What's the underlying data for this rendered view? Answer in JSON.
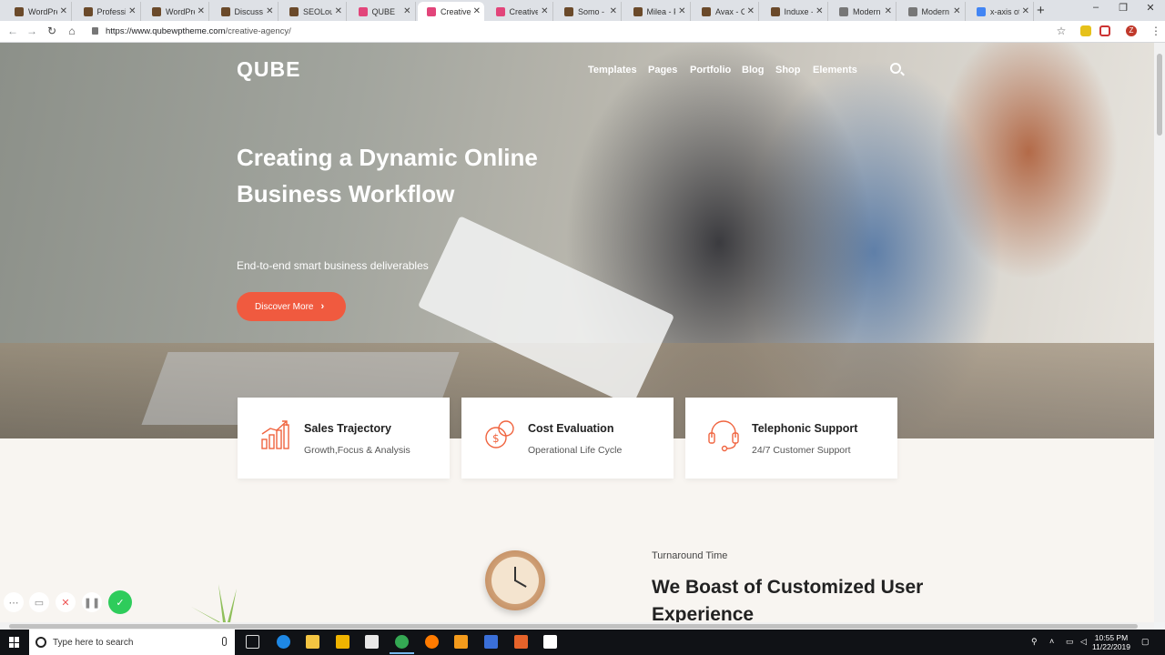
{
  "browser": {
    "tabs": [
      {
        "title": "WordPre",
        "favicon": "#6b4a2a"
      },
      {
        "title": "Professio",
        "favicon": "#6b4a2a"
      },
      {
        "title": "WordPre",
        "favicon": "#6b4a2a"
      },
      {
        "title": "Discussi",
        "favicon": "#6b4a2a"
      },
      {
        "title": "SEOLoun",
        "favicon": "#6b4a2a"
      },
      {
        "title": "QUBE",
        "favicon": "#e2457a"
      },
      {
        "title": "Creative",
        "favicon": "#e2457a",
        "active": true
      },
      {
        "title": "Creative",
        "favicon": "#e2457a"
      },
      {
        "title": "Somo - C",
        "favicon": "#6b4a2a"
      },
      {
        "title": "Milea - F",
        "favicon": "#6b4a2a"
      },
      {
        "title": "Avax - Cr",
        "favicon": "#6b4a2a"
      },
      {
        "title": "Induxe -",
        "favicon": "#6b4a2a"
      },
      {
        "title": "Modern",
        "favicon": "#777777"
      },
      {
        "title": "Modern",
        "favicon": "#777777"
      },
      {
        "title": "x-axis of",
        "favicon": "#4285f4"
      }
    ],
    "url_domain": "https://www.qubewptheme.com",
    "url_path": "/creative-agency/",
    "profile_initial": "Z"
  },
  "site": {
    "logo": "QUBE",
    "nav": [
      "Templates",
      "Pages",
      "Portfolio",
      "Blog",
      "Shop",
      "Elements"
    ],
    "hero_title": "Creating a Dynamic Online Business Workflow",
    "hero_subtitle": "End-to-end smart business deliverables",
    "cta_label": "Discover More",
    "features": [
      {
        "title": "Sales Trajectory",
        "subtitle": "Growth,Focus & Analysis",
        "icon": "chart-icon"
      },
      {
        "title": "Cost Evaluation",
        "subtitle": "Operational Life Cycle",
        "icon": "coins-icon"
      },
      {
        "title": "Telephonic Support",
        "subtitle": "24/7 Customer Support",
        "icon": "headset-icon"
      }
    ],
    "section_eyebrow": "Turnaround Time",
    "section_title": "We Boast of Customized User Experience"
  },
  "taskbar": {
    "search_placeholder": "Type here to search",
    "time": "10:55 PM",
    "date": "11/22/2019"
  },
  "colors": {
    "accent": "#f05a3f",
    "icon_stroke": "#f0643f"
  }
}
